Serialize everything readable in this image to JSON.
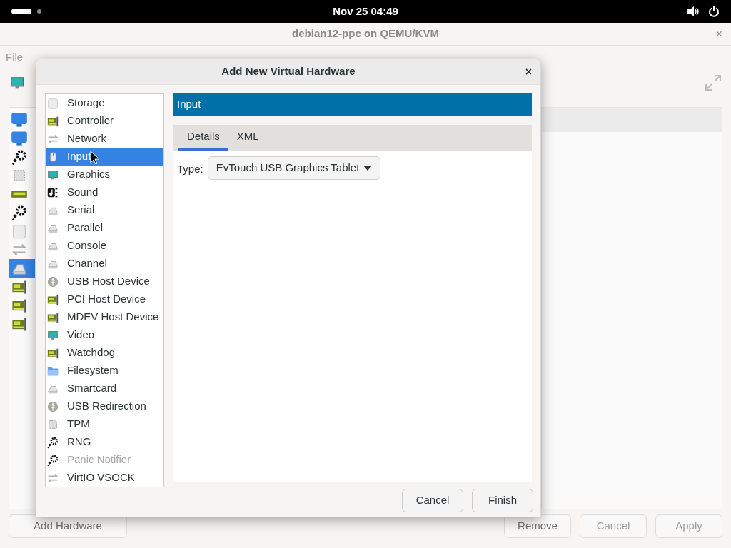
{
  "topbar": {
    "clock": "Nov 25  04:49"
  },
  "window": {
    "title": "debian12-ppc on QEMU/KVM",
    "close": "×"
  },
  "menu": [
    "File"
  ],
  "vm_sidebar": [
    {
      "kind": "monitor",
      "selected": false
    },
    {
      "kind": "monitor",
      "selected": false
    },
    {
      "kind": "gears",
      "selected": false
    },
    {
      "kind": "chip",
      "selected": false
    },
    {
      "kind": "ram",
      "selected": false
    },
    {
      "kind": "gears",
      "selected": false
    },
    {
      "kind": "disk",
      "selected": false
    },
    {
      "kind": "arrows",
      "selected": false
    },
    {
      "kind": "serial",
      "selected": true
    },
    {
      "kind": "card",
      "selected": false
    },
    {
      "kind": "card",
      "selected": false
    },
    {
      "kind": "card",
      "selected": false
    }
  ],
  "footer_buttons": [
    {
      "label": "Add Hardware",
      "disabled": false
    },
    {
      "label": "Remove",
      "disabled": false
    },
    {
      "label": "Cancel",
      "disabled": true
    },
    {
      "label": "Apply",
      "disabled": true
    }
  ],
  "dialog": {
    "title": "Add New Virtual Hardware",
    "close": "×",
    "items": [
      {
        "label": "Storage",
        "kind": "disk",
        "selected": false,
        "disabled": false
      },
      {
        "label": "Controller",
        "kind": "card",
        "selected": false,
        "disabled": false
      },
      {
        "label": "Network",
        "kind": "arrows",
        "selected": false,
        "disabled": false
      },
      {
        "label": "Input",
        "kind": "mouse",
        "selected": true,
        "disabled": false
      },
      {
        "label": "Graphics",
        "kind": "monitor",
        "selected": false,
        "disabled": false
      },
      {
        "label": "Sound",
        "kind": "sound",
        "selected": false,
        "disabled": false
      },
      {
        "label": "Serial",
        "kind": "serial",
        "selected": false,
        "disabled": false
      },
      {
        "label": "Parallel",
        "kind": "serial",
        "selected": false,
        "disabled": false
      },
      {
        "label": "Console",
        "kind": "serial",
        "selected": false,
        "disabled": false
      },
      {
        "label": "Channel",
        "kind": "serial",
        "selected": false,
        "disabled": false
      },
      {
        "label": "USB Host Device",
        "kind": "usb",
        "selected": false,
        "disabled": false
      },
      {
        "label": "PCI Host Device",
        "kind": "card",
        "selected": false,
        "disabled": false
      },
      {
        "label": "MDEV Host Device",
        "kind": "card",
        "selected": false,
        "disabled": false
      },
      {
        "label": "Video",
        "kind": "monitor",
        "selected": false,
        "disabled": false
      },
      {
        "label": "Watchdog",
        "kind": "card",
        "selected": false,
        "disabled": false
      },
      {
        "label": "Filesystem",
        "kind": "folder",
        "selected": false,
        "disabled": false
      },
      {
        "label": "Smartcard",
        "kind": "serial",
        "selected": false,
        "disabled": false
      },
      {
        "label": "USB Redirection",
        "kind": "usb",
        "selected": false,
        "disabled": false
      },
      {
        "label": "TPM",
        "kind": "chip",
        "selected": false,
        "disabled": false
      },
      {
        "label": "RNG",
        "kind": "gears",
        "selected": false,
        "disabled": false
      },
      {
        "label": "Panic Notifier",
        "kind": "gears",
        "selected": false,
        "disabled": true
      },
      {
        "label": "VirtIO VSOCK",
        "kind": "arrows",
        "selected": false,
        "disabled": false
      }
    ],
    "header": "Input",
    "tabs": [
      {
        "label": "Details",
        "selected": true
      },
      {
        "label": "XML",
        "selected": false
      }
    ],
    "type_label": "Type:",
    "type_value": "EvTouch USB Graphics Tablet",
    "buttons": [
      "Cancel",
      "Finish"
    ]
  }
}
